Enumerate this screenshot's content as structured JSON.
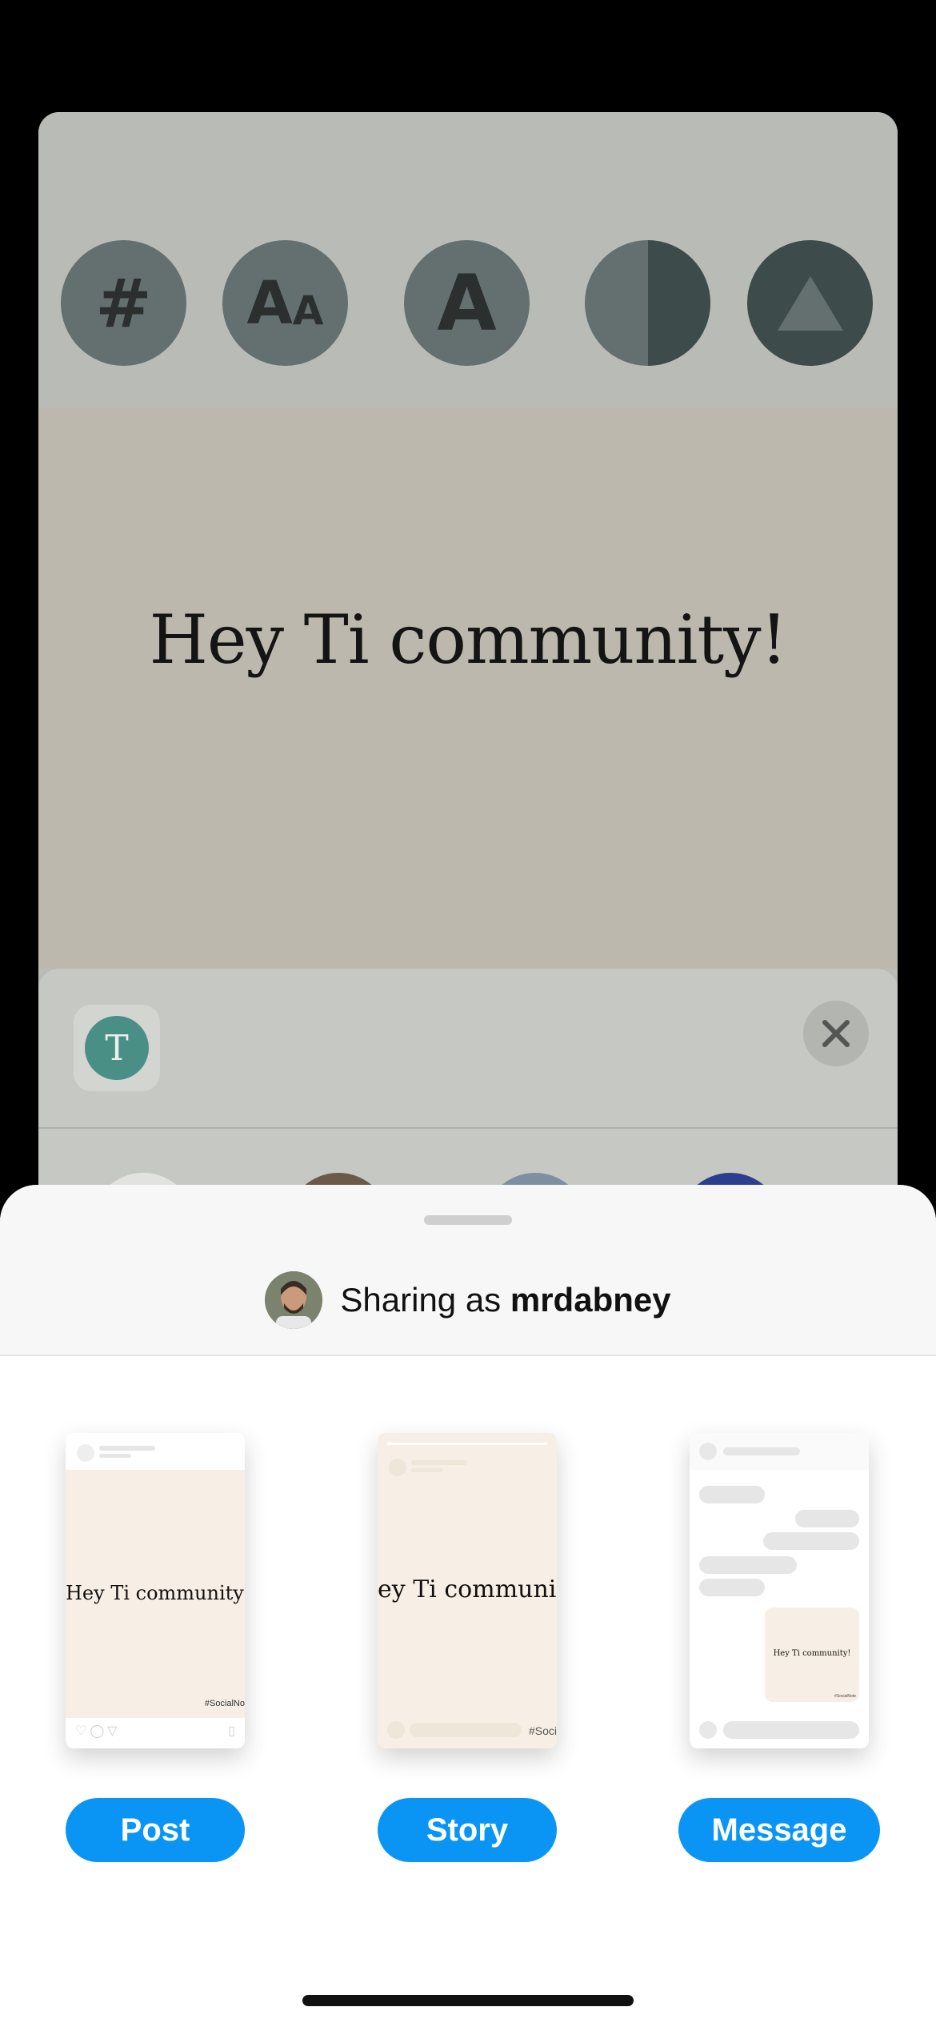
{
  "background": {
    "tools": [
      {
        "icon": "hashtag-icon",
        "glyph": "#"
      },
      {
        "icon": "font-size-icon",
        "glyph_big": "A",
        "glyph_small": "A"
      },
      {
        "icon": "font-style-icon",
        "glyph": "A"
      },
      {
        "icon": "contrast-icon"
      },
      {
        "icon": "triangle-icon"
      }
    ],
    "canvas_text": "Hey Ti community!",
    "app_icon_letter": "T"
  },
  "sheet": {
    "sharing_prefix": "Sharing as",
    "username": "mrdabney",
    "options": [
      {
        "label": "Post",
        "preview_text": "Hey Ti community!",
        "tag": "#SocialNo"
      },
      {
        "label": "Story",
        "preview_text": "ey Ti communit",
        "tag": "#Soci"
      },
      {
        "label": "Message",
        "preview_text": "Hey Ti community!",
        "tag": "#SocialNote"
      }
    ]
  },
  "colors": {
    "accent": "#0a95f5",
    "preview_bg": "#f7efe5"
  }
}
